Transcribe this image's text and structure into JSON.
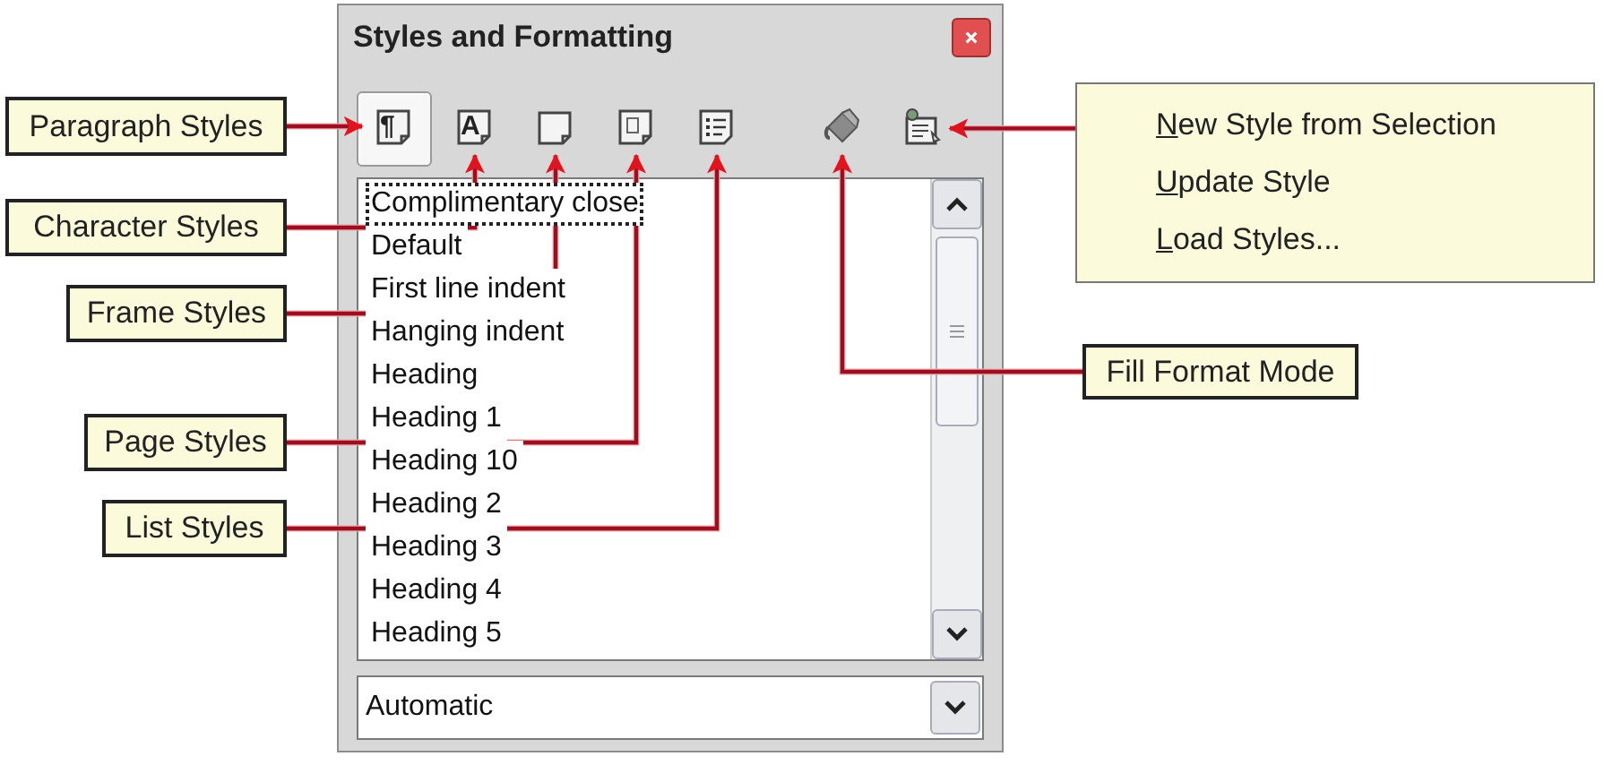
{
  "window": {
    "title": "Styles and Formatting"
  },
  "toolbar": [
    {
      "kind": "paragraph",
      "glyph": "¶",
      "selected": true
    },
    {
      "kind": "character",
      "glyph": "A",
      "selected": false
    },
    {
      "kind": "frame",
      "selected": false
    },
    {
      "kind": "page",
      "selected": false
    },
    {
      "kind": "list",
      "selected": false
    },
    {
      "kind": "fill",
      "selected": false
    },
    {
      "kind": "new",
      "selected": false
    }
  ],
  "styles": [
    {
      "label": "Complimentary close",
      "focused": true
    },
    {
      "label": "Default",
      "focused": false
    },
    {
      "label": "First line indent",
      "focused": false
    },
    {
      "label": "Hanging indent",
      "focused": false
    },
    {
      "label": "Heading",
      "focused": false
    },
    {
      "label": "Heading 1",
      "focused": false
    },
    {
      "label": "Heading 10",
      "focused": false
    },
    {
      "label": "Heading 2",
      "focused": false
    },
    {
      "label": "Heading 3",
      "focused": false
    },
    {
      "label": "Heading 4",
      "focused": false
    },
    {
      "label": "Heading 5",
      "focused": false
    }
  ],
  "style_filter": {
    "value": "Automatic"
  },
  "callouts": [
    {
      "label": "Paragraph Styles"
    },
    {
      "label": "Character Styles"
    },
    {
      "label": "Frame Styles"
    },
    {
      "label": "Page Styles"
    },
    {
      "label": "List Styles"
    },
    {
      "label": "Fill Format Mode"
    }
  ],
  "menu": {
    "items": [
      {
        "mnemonic": "N",
        "rest": "ew Style from Selection"
      },
      {
        "mnemonic": "U",
        "rest": "pdate Style"
      },
      {
        "mnemonic": "L",
        "rest": "oad Styles..."
      }
    ]
  }
}
